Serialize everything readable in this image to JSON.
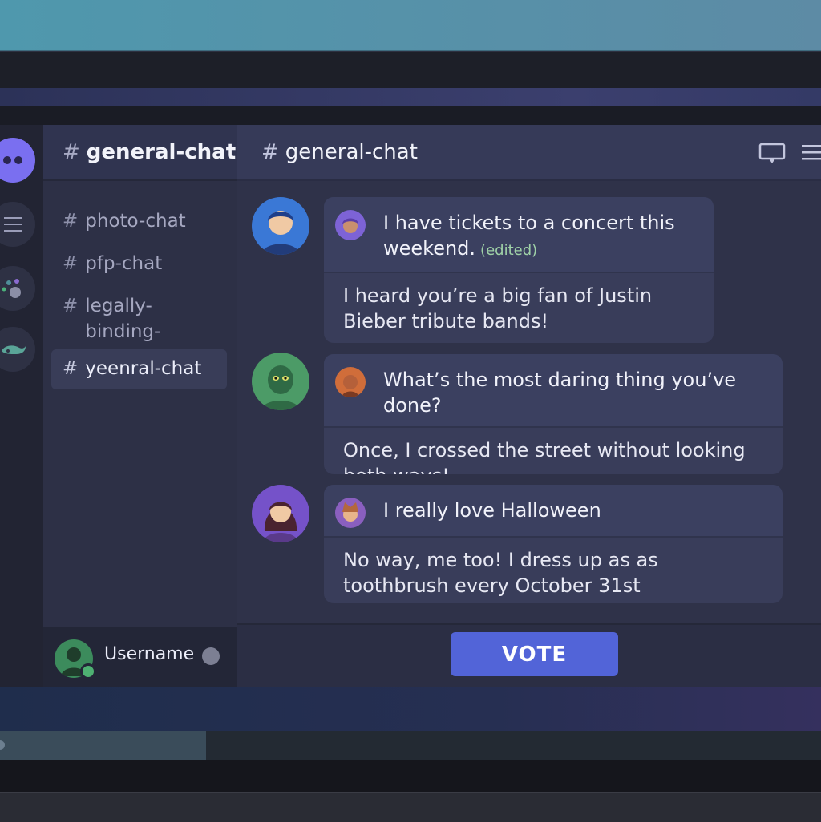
{
  "server_rail": {
    "icons": [
      "discord-logo-icon",
      "menu-icon",
      "server-dots-icon",
      "server-whale-icon"
    ]
  },
  "channels": {
    "header_title": "general-chat",
    "hash": "#",
    "items": [
      {
        "label": "photo-chat"
      },
      {
        "label": "pfp-chat"
      },
      {
        "label": "legally-binding-documentation"
      },
      {
        "label": "yeenral-chat",
        "active": true
      }
    ]
  },
  "user": {
    "name": "Username"
  },
  "chat": {
    "header_title": "general-chat",
    "messages": [
      {
        "question": "I have tickets to a concert this weekend.",
        "edited": "(edited)",
        "answer": "I heard you’re a big fan of Justin Bieber tribute bands!"
      },
      {
        "question": "What’s the most daring thing you’ve done?",
        "answer": "Once, I crossed the street without looking both ways!"
      },
      {
        "question": "I really love Halloween",
        "answer": "No way, me too! I dress up as as toothbrush every October 31st"
      }
    ],
    "vote_label": "VOTE"
  },
  "colors": {
    "accent": "#5264d8",
    "online": "#4eb072",
    "edited": "#9fd1a7"
  }
}
